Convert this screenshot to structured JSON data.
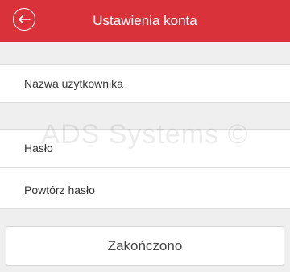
{
  "header": {
    "title": "Ustawienia konta",
    "back_icon": "arrow-left-circle-icon",
    "background_color": "#d9323a"
  },
  "form": {
    "username_label": "Nazwa użytkownika",
    "password_label": "Hasło",
    "repeat_password_label": "Powtórz hasło"
  },
  "watermark": {
    "text": "ADS Systems ©"
  },
  "actions": {
    "done_label": "Zakończono"
  }
}
